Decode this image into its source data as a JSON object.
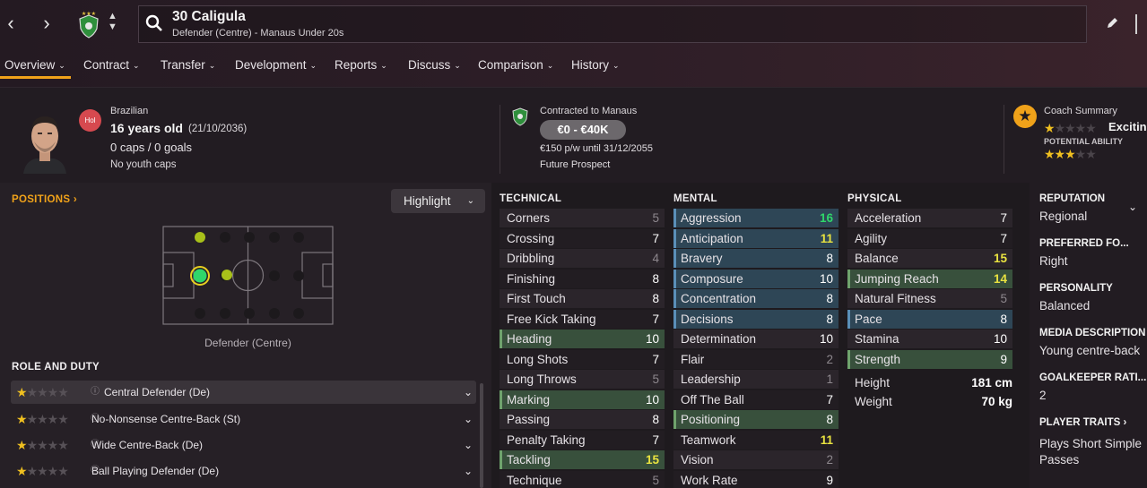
{
  "header": {
    "player_title": "30 Caligula",
    "player_subtitle": "Defender (Centre) - Manaus Under 20s"
  },
  "nav": {
    "back_icon": "chevron-left-icon",
    "forward_icon": "chevron-right-icon",
    "tabs": [
      {
        "label": "Overview"
      },
      {
        "label": "Contract"
      },
      {
        "label": "Transfer"
      },
      {
        "label": "Development"
      },
      {
        "label": "Reports"
      },
      {
        "label": "Discuss"
      },
      {
        "label": "Comparison"
      },
      {
        "label": "History"
      }
    ],
    "accent": "#f0a21a"
  },
  "info": {
    "badge": "Hol",
    "nationality": "Brazilian",
    "age": "16 years old",
    "dob": "(21/10/2036)",
    "caps": "0 caps / 0 goals",
    "youth_caps": "No youth caps",
    "contract_label": "Contracted to Manaus",
    "value_range": "€0 - €40K",
    "wage": "€150 p/w until 31/12/2055",
    "prospect": "Future Prospect",
    "coach_summary": "Coach Summary",
    "coach_word": "Excitin",
    "potential_label": "POTENTIAL ABILITY"
  },
  "positions": {
    "title": "POSITIONS",
    "highlight_label": "Highlight",
    "position_name": "Defender (Centre)",
    "role_title": "ROLE AND DUTY",
    "roles": [
      {
        "label": "Central Defender (De)"
      },
      {
        "label": "No-Nonsense Centre-Back (St)"
      },
      {
        "label": "Wide Centre-Back (De)"
      },
      {
        "label": "Ball Playing Defender (De)"
      }
    ]
  },
  "attributes": {
    "technical_title": "TECHNICAL",
    "mental_title": "MENTAL",
    "physical_title": "PHYSICAL",
    "technical": [
      {
        "name": "Corners",
        "value": "5",
        "color": "grey",
        "hl": ""
      },
      {
        "name": "Crossing",
        "value": "7",
        "color": "white",
        "hl": ""
      },
      {
        "name": "Dribbling",
        "value": "4",
        "color": "grey",
        "hl": ""
      },
      {
        "name": "Finishing",
        "value": "8",
        "color": "white",
        "hl": ""
      },
      {
        "name": "First Touch",
        "value": "8",
        "color": "white",
        "hl": ""
      },
      {
        "name": "Free Kick Taking",
        "value": "7",
        "color": "white",
        "hl": ""
      },
      {
        "name": "Heading",
        "value": "10",
        "color": "white",
        "hl": "green"
      },
      {
        "name": "Long Shots",
        "value": "7",
        "color": "white",
        "hl": ""
      },
      {
        "name": "Long Throws",
        "value": "5",
        "color": "grey",
        "hl": ""
      },
      {
        "name": "Marking",
        "value": "10",
        "color": "white",
        "hl": "green"
      },
      {
        "name": "Passing",
        "value": "8",
        "color": "white",
        "hl": ""
      },
      {
        "name": "Penalty Taking",
        "value": "7",
        "color": "white",
        "hl": ""
      },
      {
        "name": "Tackling",
        "value": "15",
        "color": "yellow",
        "hl": "green"
      },
      {
        "name": "Technique",
        "value": "5",
        "color": "grey",
        "hl": ""
      }
    ],
    "mental": [
      {
        "name": "Aggression",
        "value": "16",
        "color": "green",
        "hl": "blue"
      },
      {
        "name": "Anticipation",
        "value": "11",
        "color": "yellow",
        "hl": "blue"
      },
      {
        "name": "Bravery",
        "value": "8",
        "color": "white",
        "hl": "blue"
      },
      {
        "name": "Composure",
        "value": "10",
        "color": "white",
        "hl": "blue"
      },
      {
        "name": "Concentration",
        "value": "8",
        "color": "white",
        "hl": "blue"
      },
      {
        "name": "Decisions",
        "value": "8",
        "color": "white",
        "hl": "blue"
      },
      {
        "name": "Determination",
        "value": "10",
        "color": "white",
        "hl": ""
      },
      {
        "name": "Flair",
        "value": "2",
        "color": "grey",
        "hl": ""
      },
      {
        "name": "Leadership",
        "value": "1",
        "color": "grey",
        "hl": ""
      },
      {
        "name": "Off The Ball",
        "value": "7",
        "color": "white",
        "hl": ""
      },
      {
        "name": "Positioning",
        "value": "8",
        "color": "white",
        "hl": "green"
      },
      {
        "name": "Teamwork",
        "value": "11",
        "color": "yellow",
        "hl": ""
      },
      {
        "name": "Vision",
        "value": "2",
        "color": "grey",
        "hl": ""
      },
      {
        "name": "Work Rate",
        "value": "9",
        "color": "white",
        "hl": ""
      }
    ],
    "physical": [
      {
        "name": "Acceleration",
        "value": "7",
        "color": "white",
        "hl": ""
      },
      {
        "name": "Agility",
        "value": "7",
        "color": "white",
        "hl": ""
      },
      {
        "name": "Balance",
        "value": "15",
        "color": "yellow",
        "hl": ""
      },
      {
        "name": "Jumping Reach",
        "value": "14",
        "color": "yellow",
        "hl": "green"
      },
      {
        "name": "Natural Fitness",
        "value": "5",
        "color": "grey",
        "hl": ""
      },
      {
        "name": "Pace",
        "value": "8",
        "color": "white",
        "hl": "blue"
      },
      {
        "name": "Stamina",
        "value": "10",
        "color": "white",
        "hl": ""
      },
      {
        "name": "Strength",
        "value": "9",
        "color": "white",
        "hl": "green"
      }
    ],
    "height_label": "Height",
    "height_value": "181 cm",
    "weight_label": "Weight",
    "weight_value": "70 kg"
  },
  "side": {
    "reputation_label": "REPUTATION",
    "reputation_value": "Regional",
    "foot_label": "PREFERRED FO...",
    "foot_value": "Right",
    "personality_label": "PERSONALITY",
    "personality_value": "Balanced",
    "media_label": "MEDIA DESCRIPTION",
    "media_value": "Young centre-back",
    "gk_label": "GOALKEEPER RATI...",
    "gk_value": "2",
    "traits_label": "PLAYER TRAITS",
    "traits_value": "Plays Short Simple Passes"
  }
}
